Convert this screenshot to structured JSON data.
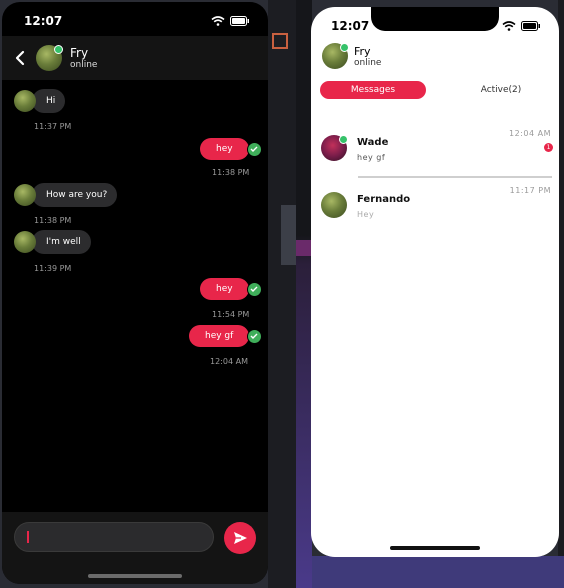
{
  "left_phone": {
    "status": {
      "time": "12:07"
    },
    "header": {
      "name": "Fry",
      "subtitle": "online"
    },
    "messages": [
      {
        "direction": "in",
        "text": "Hi",
        "time": "11:37 PM"
      },
      {
        "direction": "out",
        "text": "hey",
        "time": "11:38 PM"
      },
      {
        "direction": "in",
        "text": "How are you?",
        "time": "11:38 PM"
      },
      {
        "direction": "in",
        "text": "I'm well",
        "time": "11:39 PM"
      },
      {
        "direction": "out",
        "text": "hey",
        "time": "11:54 PM"
      },
      {
        "direction": "out",
        "text": "hey gf",
        "time": "12:04 AM"
      }
    ],
    "input": {
      "value": "",
      "placeholder": ""
    }
  },
  "right_phone": {
    "status": {
      "time": "12:07"
    },
    "header": {
      "name": "Fry",
      "subtitle": "online"
    },
    "tabs": [
      {
        "label": "Messages",
        "selected": true
      },
      {
        "label": "Active(2)",
        "selected": false
      }
    ],
    "conversations": [
      {
        "name": "Wade",
        "preview": "hey gf",
        "time": "12:04 AM",
        "unread": "1"
      },
      {
        "name": "Fernando",
        "preview": "Hey",
        "time": "11:17 PM",
        "unread": ""
      }
    ]
  },
  "colors": {
    "accent": "#e8264a",
    "online": "#36c26a",
    "check": "#3fae5a"
  },
  "icons": [
    "back-icon",
    "send-icon",
    "wifi-icon",
    "battery-icon",
    "checkmark-icon"
  ]
}
